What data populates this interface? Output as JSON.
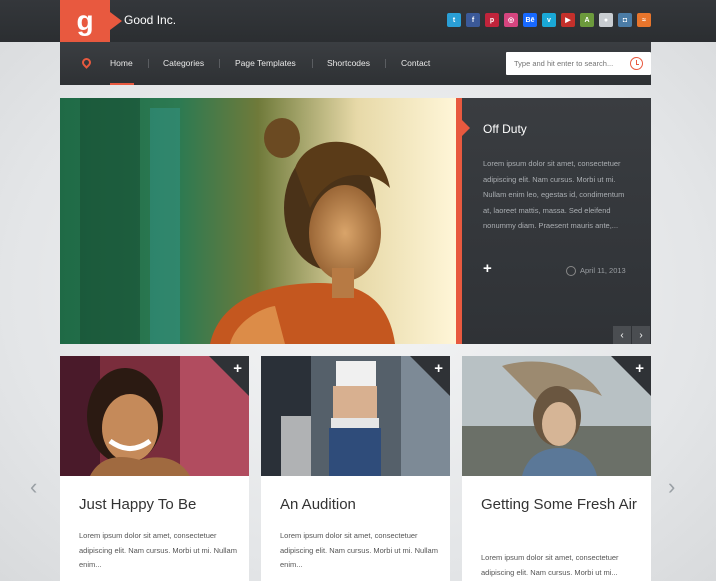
{
  "header": {
    "logo_letter": "g",
    "brand": "Good Inc.",
    "social_icons": [
      {
        "name": "twitter-icon",
        "glyph": "t",
        "color": "#2a9fd6"
      },
      {
        "name": "facebook-icon",
        "glyph": "f",
        "color": "#3b5998"
      },
      {
        "name": "pinterest-icon",
        "glyph": "p",
        "color": "#c0243b"
      },
      {
        "name": "dribbble-icon",
        "glyph": "◎",
        "color": "#d6457f"
      },
      {
        "name": "behance-icon",
        "glyph": "Bē",
        "color": "#1769ff"
      },
      {
        "name": "vimeo-icon",
        "glyph": "v",
        "color": "#1aa8d6"
      },
      {
        "name": "youtube-icon",
        "glyph": "▶",
        "color": "#c4302b"
      },
      {
        "name": "android-icon",
        "glyph": "A",
        "color": "#6c9a3c"
      },
      {
        "name": "github-icon",
        "glyph": "●",
        "color": "#c9cdd1"
      },
      {
        "name": "instagram-icon",
        "glyph": "◘",
        "color": "#4b7ca6"
      },
      {
        "name": "rss-icon",
        "glyph": "≈",
        "color": "#e8752c"
      }
    ]
  },
  "nav": {
    "items": [
      "Home",
      "Categories",
      "Page Templates",
      "Shortcodes",
      "Contact"
    ],
    "active": "Home",
    "search_placeholder": "Type and hit enter to search..."
  },
  "featured": {
    "title": "Off Duty",
    "excerpt": "Lorem ipsum dolor sit amet, consectetuer adipiscing elit. Nam cursus. Morbi ut mi. Nullam enim leo, egestas id, condimentum at, laoreet mattis, massa. Sed eleifend nonummy diam. Praesent mauris ante,...",
    "date": "April 11, 2013",
    "prev": "‹",
    "next": "›"
  },
  "cards": [
    {
      "title": "Just Happy To Be",
      "excerpt": "Lorem ipsum dolor sit amet, consectetuer adipiscing elit. Nam cursus. Morbi ut mi. Nullam enim..."
    },
    {
      "title": "An Audition",
      "excerpt": "Lorem ipsum dolor sit amet, consectetuer adipiscing elit. Nam cursus. Morbi ut mi. Nullam enim..."
    },
    {
      "title": "Getting Some Fresh Air",
      "excerpt": "Lorem ipsum dolor sit amet, consectetuer adipiscing elit. Nam cursus. Morbi ut mi..."
    }
  ],
  "carousel": {
    "prev": "‹",
    "next": "›"
  },
  "plus_glyph": "+"
}
